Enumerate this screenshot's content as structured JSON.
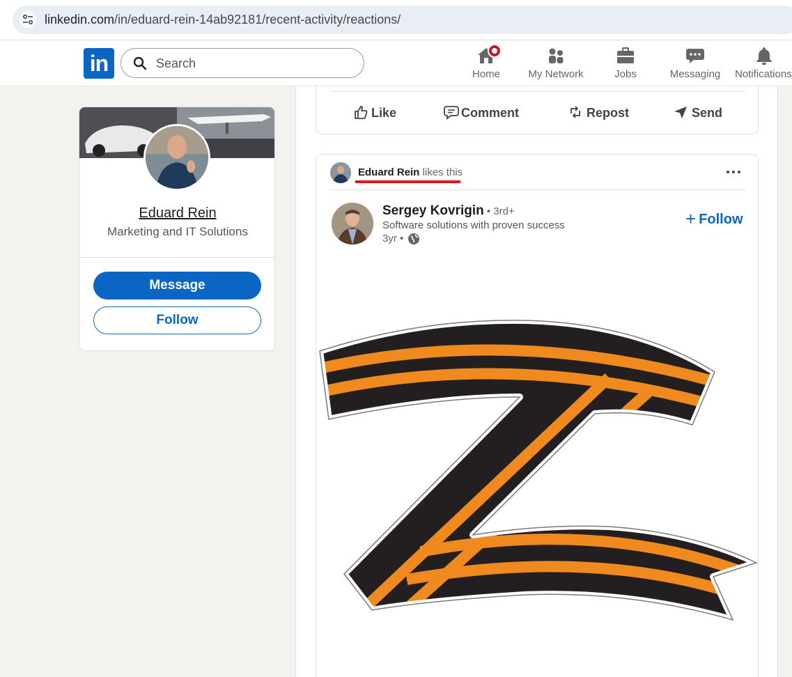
{
  "browser": {
    "url_domain": "linkedin.com",
    "url_path": "/in/eduard-rein-14ab92181/recent-activity/reactions/"
  },
  "header": {
    "logo_text": "in",
    "search_placeholder": "Search",
    "nav": [
      {
        "label": "Home",
        "icon": "home-icon",
        "has_badge": true
      },
      {
        "label": "My Network",
        "icon": "people-icon"
      },
      {
        "label": "Jobs",
        "icon": "briefcase-icon"
      },
      {
        "label": "Messaging",
        "icon": "chat-icon"
      },
      {
        "label": "Notifications",
        "icon": "bell-icon"
      }
    ]
  },
  "profile": {
    "name": "Eduard Rein",
    "headline": "Marketing and IT Solutions",
    "message_label": "Message",
    "follow_label": "Follow"
  },
  "prev_post_actions": {
    "like": "Like",
    "comment": "Comment",
    "repost": "Repost",
    "send": "Send"
  },
  "post": {
    "liker_name": "Eduard Rein",
    "liker_action": " likes this",
    "author_name": "Sergey Kovrigin",
    "author_degree": " • 3rd+",
    "author_subtitle": "Software solutions with proven success",
    "time": "3yr •",
    "follow_label": "Follow",
    "image_icon": "z-ribbon-symbol-image"
  },
  "colors": {
    "brand": "#0a66c2",
    "badge": "#cb112d",
    "highlight_underline": "#e0141e",
    "ribbon_orange": "#f08a1e",
    "ribbon_black": "#231f20"
  }
}
